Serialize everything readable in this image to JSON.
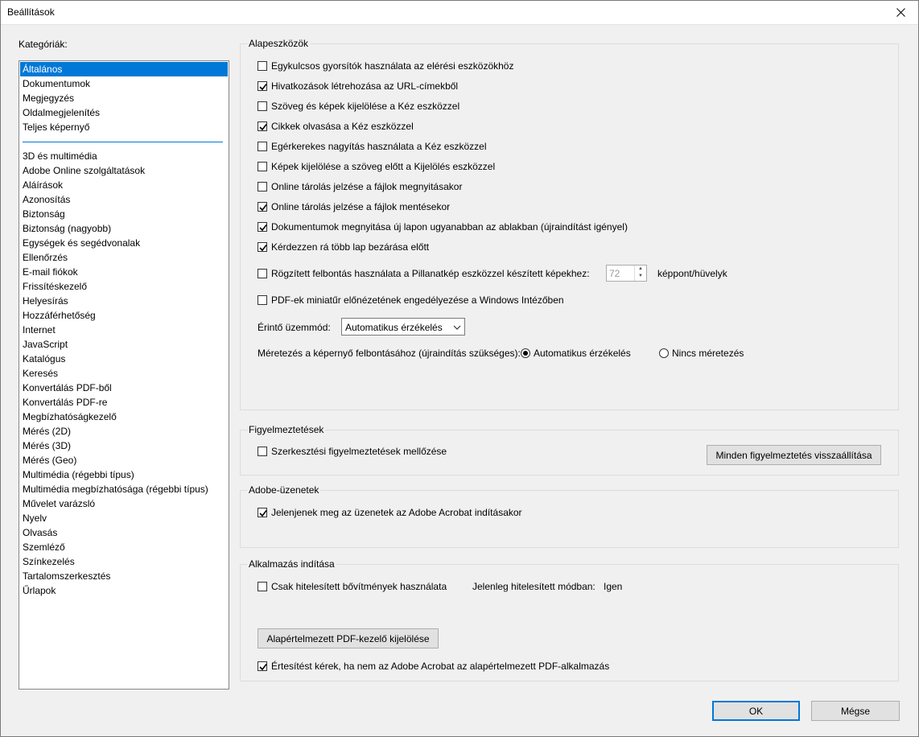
{
  "window": {
    "title": "Beállítások"
  },
  "categories": {
    "label": "Kategóriák:",
    "group1": [
      "Általános",
      "Dokumentumok",
      "Megjegyzés",
      "Oldalmegjelenítés",
      "Teljes képernyő"
    ],
    "group2": [
      "3D és multimédia",
      "Adobe Online szolgáltatások",
      "Aláírások",
      "Azonosítás",
      "Biztonság",
      "Biztonság (nagyobb)",
      "Egységek és segédvonalak",
      "Ellenőrzés",
      "E-mail fiókok",
      "Frissítéskezelő",
      "Helyesírás",
      "Hozzáférhetőség",
      "Internet",
      "JavaScript",
      "Katalógus",
      "Keresés",
      "Konvertálás PDF-ből",
      "Konvertálás PDF-re",
      "Megbízhatóságkezelő",
      "Mérés (2D)",
      "Mérés (3D)",
      "Mérés (Geo)",
      "Multimédia (régebbi típus)",
      "Multimédia megbízhatósága (régebbi típus)",
      "Művelet varázsló",
      "Nyelv",
      "Olvasás",
      "Szemléző",
      "Színkezelés",
      "Tartalomszerkesztés",
      "Űrlapok"
    ],
    "selected": "Általános"
  },
  "basic_tools": {
    "title": "Alapeszközök",
    "options": [
      {
        "label": "Egykulcsos gyorsítók használata az elérési eszközökhöz",
        "checked": false
      },
      {
        "label": "Hivatkozások létrehozása az URL-címekből",
        "checked": true
      },
      {
        "label": "Szöveg és képek kijelölése a Kéz eszközzel",
        "checked": false
      },
      {
        "label": "Cikkek olvasása a Kéz eszközzel",
        "checked": true
      },
      {
        "label": "Egérkerekes nagyítás használata a Kéz eszközzel",
        "checked": false
      },
      {
        "label": "Képek kijelölése a szöveg előtt a Kijelölés eszközzel",
        "checked": false
      },
      {
        "label": "Online tárolás jelzése a fájlok megnyitásakor",
        "checked": false
      },
      {
        "label": "Online tárolás jelzése a fájlok mentésekor",
        "checked": true
      },
      {
        "label": "Dokumentumok megnyitása új lapon ugyanabban az ablakban (újraindítást igényel)",
        "checked": true
      },
      {
        "label": "Kérdezzen rá több lap bezárása előtt",
        "checked": true
      }
    ],
    "fixed_resolution": {
      "label": "Rögzített felbontás használata a Pillanatkép eszközzel készített képekhez:",
      "checked": false,
      "value": "72",
      "unit": "képpont/hüvelyk"
    },
    "thumbnail": {
      "label": "PDF-ek miniatűr előnézetének engedélyezése a Windows Intézőben",
      "checked": false
    },
    "touch_mode": {
      "label": "Érintő üzemmód:",
      "value": "Automatikus érzékelés"
    },
    "scaling": {
      "label": "Méretezés a képernyő felbontásához (újraindítás szükséges):",
      "option_auto": "Automatikus érzékelés",
      "option_none": "Nincs méretezés",
      "selected": "auto"
    }
  },
  "warnings": {
    "title": "Figyelmeztetések",
    "ignore_label": "Szerkesztési figyelmeztetések mellőzése",
    "ignore_checked": false,
    "reset_button": "Minden figyelmeztetés visszaállítása"
  },
  "adobe_messages": {
    "title": "Adobe-üzenetek",
    "show_label": "Jelenjenek meg az üzenetek az Adobe Acrobat indításakor",
    "show_checked": true
  },
  "app_launch": {
    "title": "Alkalmazás indítása",
    "certified_label": "Csak hitelesített bővítmények használata",
    "certified_checked": false,
    "current_mode_label": "Jelenleg hitelesített módban:",
    "current_mode_value": "Igen",
    "default_pdf_button": "Alapértelmezett PDF-kezelő kijelölése",
    "notify_label": "Értesítést kérek, ha nem az Adobe Acrobat az alapértelmezett PDF-alkalmazás",
    "notify_checked": true
  },
  "footer": {
    "ok": "OK",
    "cancel": "Mégse"
  }
}
